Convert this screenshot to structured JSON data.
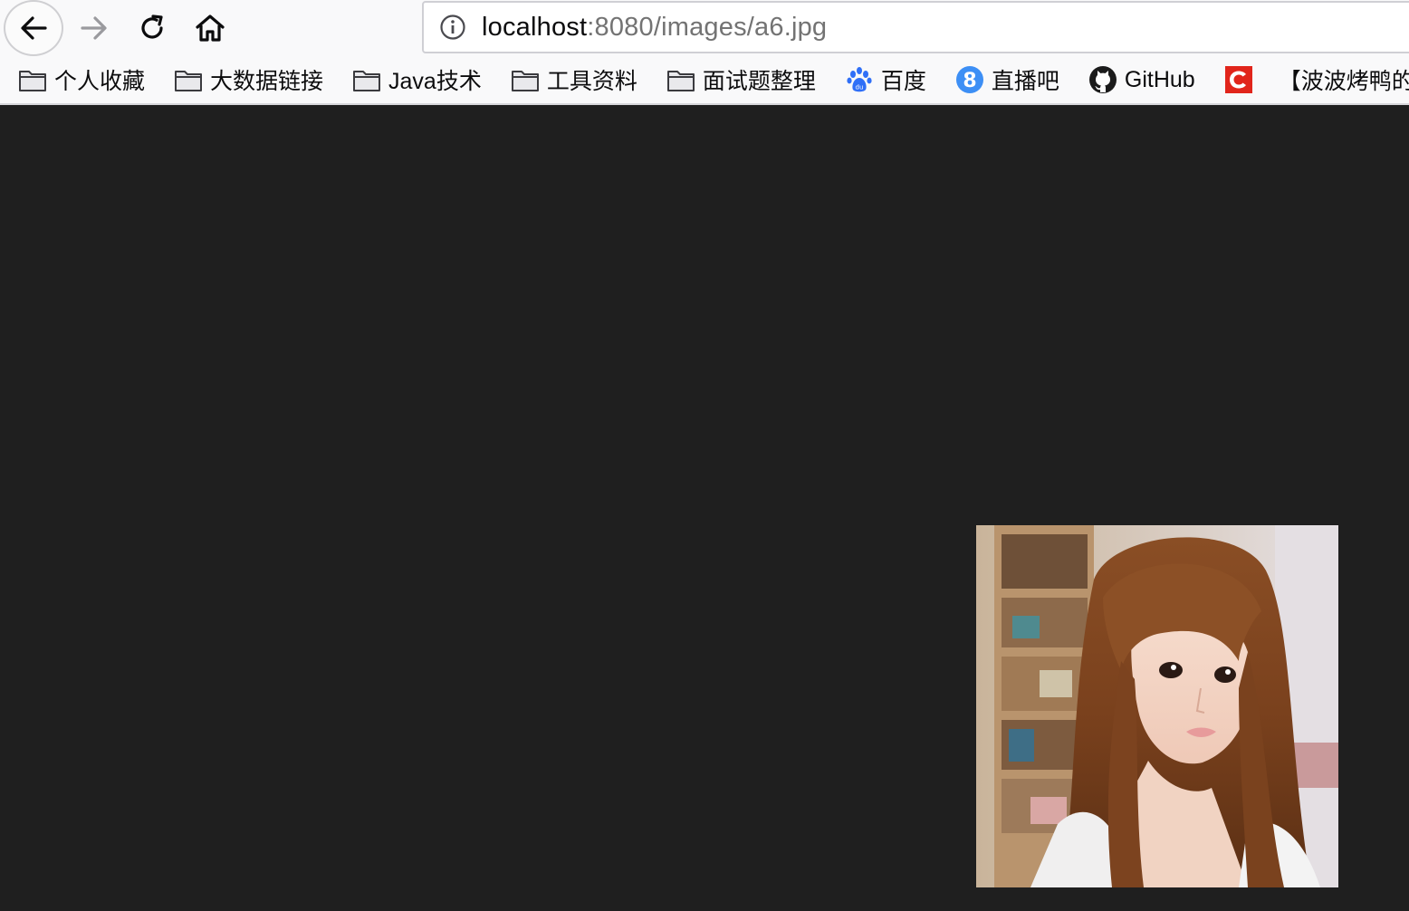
{
  "toolbar": {
    "back_icon": "arrow-left-icon",
    "forward_icon": "arrow-right-icon",
    "reload_icon": "reload-icon",
    "home_icon": "home-icon"
  },
  "urlbar": {
    "info_icon": "info-icon",
    "host": "localhost",
    "rest": ":8080/images/a6.jpg"
  },
  "bookmarks": [
    {
      "label": "个人收藏",
      "icon": "folder-icon"
    },
    {
      "label": "大数据链接",
      "icon": "folder-icon"
    },
    {
      "label": "Java技术",
      "icon": "folder-icon"
    },
    {
      "label": "工具资料",
      "icon": "folder-icon"
    },
    {
      "label": "面试题整理",
      "icon": "folder-icon"
    },
    {
      "label": "百度",
      "icon": "baidu-paw-icon"
    },
    {
      "label": "直播吧",
      "icon": "zhibo8-icon"
    },
    {
      "label": "GitHub",
      "icon": "github-icon"
    },
    {
      "label": "",
      "icon": "csdn-icon"
    },
    {
      "label": "【波波烤鸭的博客】...",
      "icon": ""
    }
  ],
  "colors": {
    "page_background": "#1f1f1f",
    "toolbar_background": "#f9f9fa",
    "baidu_blue": "#2f6ff7",
    "zhibo8_blue": "#3d8ff5",
    "csdn_red": "#e1251b"
  },
  "content": {
    "image_icon": "photo-of-girl-with-long-brown-hair"
  }
}
